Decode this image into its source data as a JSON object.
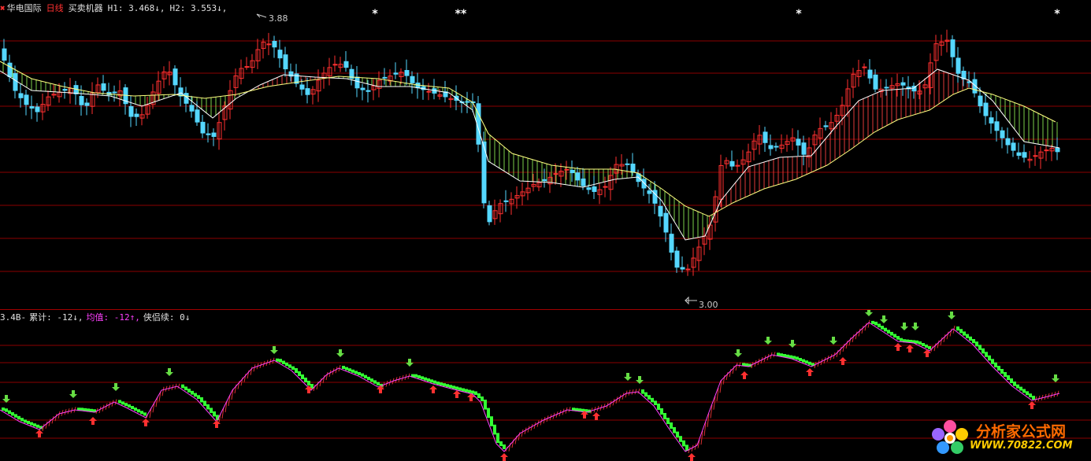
{
  "header": {
    "stock_name": "华电国际",
    "period": "日线",
    "indicator_name": "买卖机器",
    "h1": "H1: 3.468↓,",
    "h2": "H2: 3.553↓,"
  },
  "price_chart": {
    "high_label": "3.88",
    "low_label": "3.00",
    "star_glyphs": [
      "*",
      "**",
      "*",
      "*"
    ]
  },
  "indicator": {
    "prefix": "3.4B-",
    "cumulative": "累计: -12↓,",
    "average": "均值: -12↑,",
    "continuation": "侠侣续: 0↓"
  },
  "watermark": {
    "title": "分析家公式网",
    "url": "WWW.70822.COM"
  },
  "colors": {
    "up_candle": "#ff3030",
    "down_candle": "#55d7ff",
    "band_green": "#7cd14a",
    "band_red": "#e03a3a",
    "fast_line": "#ffffff",
    "slow_line": "#ffff80",
    "ind_up": "#d83030",
    "ind_down": "#33ff33",
    "ind_line": "#ff40ff",
    "arrow_up": "#ff3030",
    "arrow_down": "#66dd44",
    "grid": "#8b0000"
  }
}
